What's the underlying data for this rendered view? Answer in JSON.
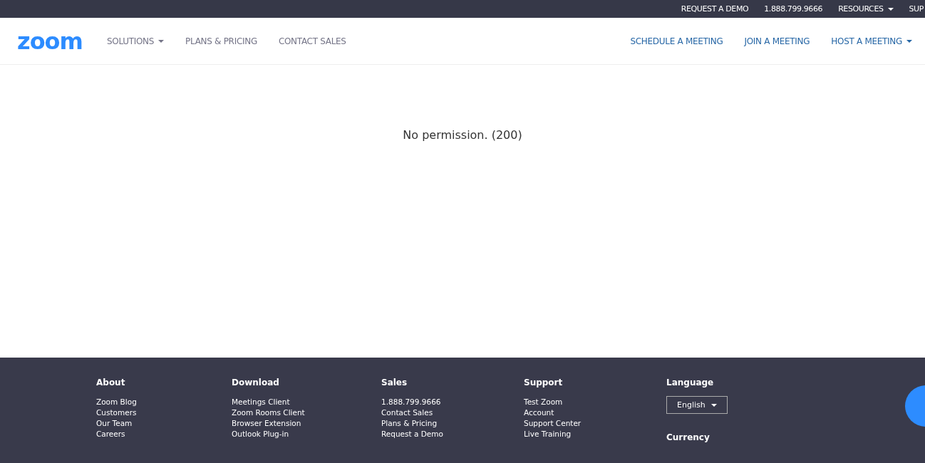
{
  "top_bar": {
    "items": [
      {
        "label": "REQUEST A DEMO",
        "has_caret": false
      },
      {
        "label": "1.888.799.9666",
        "has_caret": false
      },
      {
        "label": "RESOURCES",
        "has_caret": true
      },
      {
        "label": "SUP",
        "has_caret": false
      }
    ]
  },
  "nav": {
    "logo": "zoom",
    "left": [
      {
        "label": "SOLUTIONS",
        "has_caret": true
      },
      {
        "label": "PLANS & PRICING",
        "has_caret": false
      },
      {
        "label": "CONTACT SALES",
        "has_caret": false
      }
    ],
    "right": [
      {
        "label": "SCHEDULE A MEETING",
        "has_caret": false
      },
      {
        "label": "JOIN A MEETING",
        "has_caret": false
      },
      {
        "label": "HOST A MEETING",
        "has_caret": true
      }
    ]
  },
  "message": "No permission. (200)",
  "footer": {
    "columns": [
      {
        "heading": "About",
        "links": [
          "Zoom Blog",
          "Customers",
          "Our Team",
          "Careers"
        ]
      },
      {
        "heading": "Download",
        "links": [
          "Meetings Client",
          "Zoom Rooms Client",
          "Browser Extension",
          "Outlook Plug-in"
        ]
      },
      {
        "heading": "Sales",
        "links": [
          "1.888.799.9666",
          "Contact Sales",
          "Plans & Pricing",
          "Request a Demo"
        ]
      },
      {
        "heading": "Support",
        "links": [
          "Test Zoom",
          "Account",
          "Support Center",
          "Live Training"
        ]
      }
    ],
    "language": {
      "heading": "Language",
      "value": "English",
      "next_heading": "Currency"
    }
  }
}
